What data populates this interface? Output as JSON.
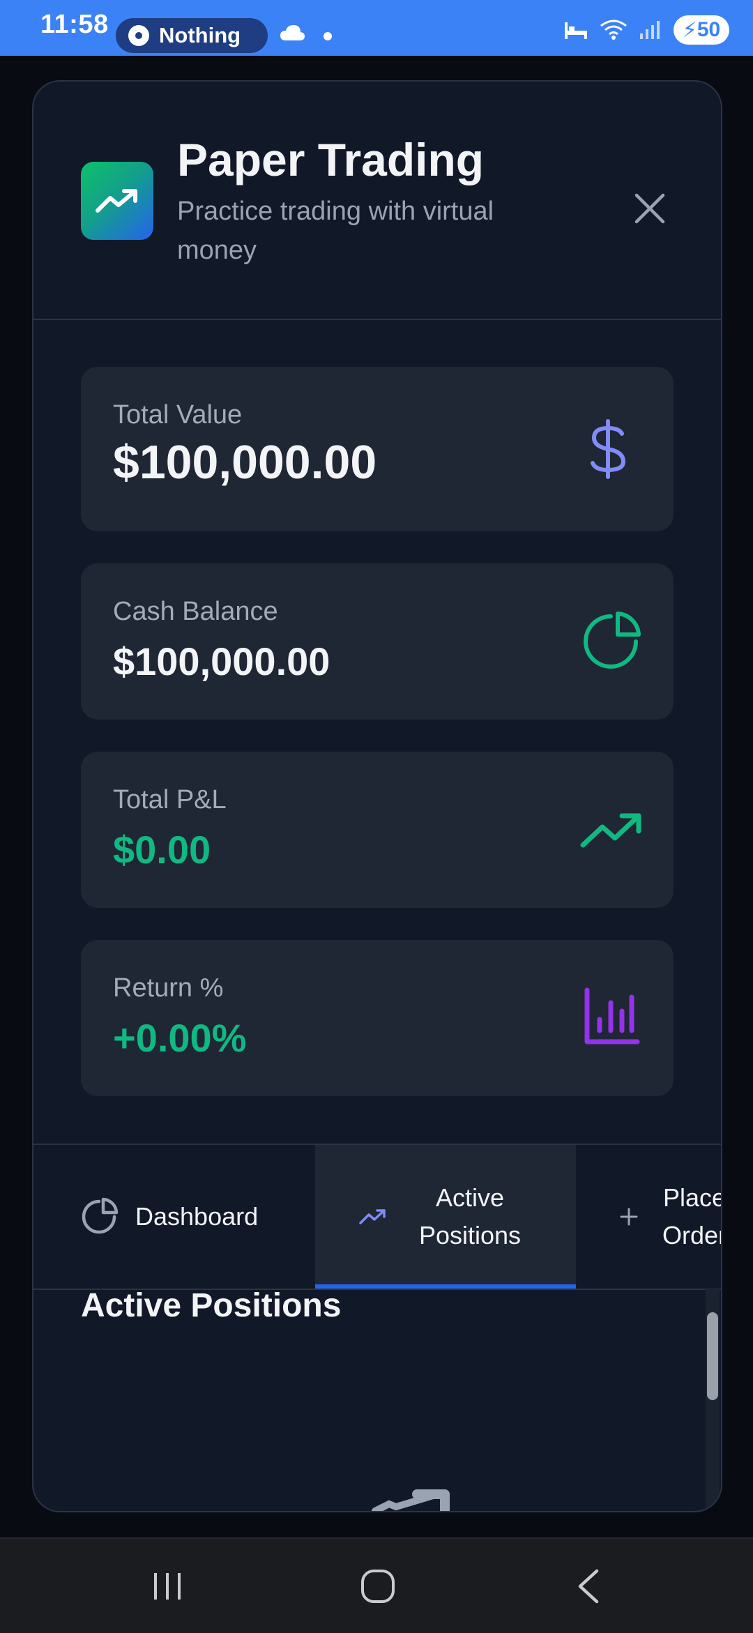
{
  "status_bar": {
    "time": "11:58",
    "notification_app": "Nothing",
    "battery_level": "50"
  },
  "modal": {
    "title": "Paper Trading",
    "subtitle": "Practice trading with virtual money",
    "app_icon": "trending-up-icon",
    "close_icon": "close-icon"
  },
  "stats": [
    {
      "label": "Total Value",
      "value": "$100,000.00",
      "icon": "dollar-icon",
      "icon_color": "#818cf8",
      "value_color": "#f3f4f6"
    },
    {
      "label": "Cash Balance",
      "value": "$100,000.00",
      "icon": "pie-chart-icon",
      "icon_color": "#10b981",
      "value_color": "#f3f4f6"
    },
    {
      "label": "Total P&L",
      "value": "$0.00",
      "icon": "trending-up-icon",
      "icon_color": "#10b981",
      "value_color": "#10b981"
    },
    {
      "label": "Return %",
      "value": "+0.00%",
      "icon": "bar-chart-icon",
      "icon_color": "#9333ea",
      "value_color": "#10b981"
    }
  ],
  "tabs": [
    {
      "label": "Dashboard",
      "icon": "pie-chart-icon",
      "active": false
    },
    {
      "label": "Active Positions",
      "icon": "trending-up-icon",
      "active": true
    },
    {
      "label": "Place Order",
      "icon": "plus-icon",
      "active": false
    }
  ],
  "section": {
    "title": "Active Positions"
  },
  "colors": {
    "accent": "#2563eb",
    "positive": "#10b981",
    "status_bar": "#3b82f6"
  }
}
